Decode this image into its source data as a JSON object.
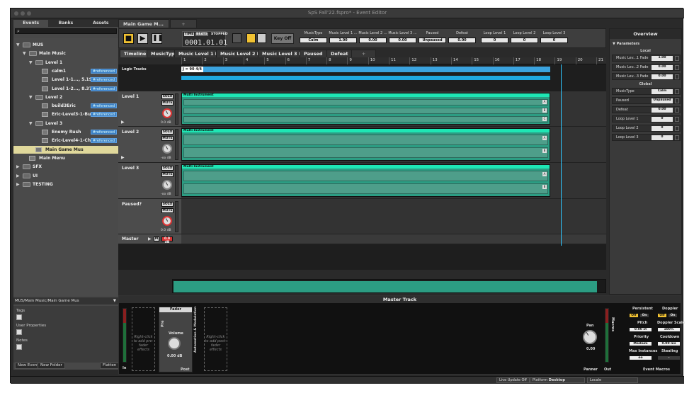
{
  "window": {
    "title": "SpS Fall'22.fspro* - Event Editor"
  },
  "browser": {
    "tabs": [
      "Events",
      "Banks",
      "Assets"
    ],
    "tree": [
      {
        "label": "MUS",
        "kind": "folder",
        "depth": 0,
        "open": true
      },
      {
        "label": "Main Music",
        "kind": "folder",
        "depth": 1,
        "open": true
      },
      {
        "label": "Level 1",
        "kind": "folder",
        "depth": 2,
        "open": true
      },
      {
        "label": "calm1",
        "kind": "event",
        "depth": 3,
        "ref": "#referenced"
      },
      {
        "label": "Level 1-1..., 5.19 PM",
        "kind": "event",
        "depth": 3,
        "ref": "#referenced"
      },
      {
        "label": "Level 1-2..., 8.37 PM",
        "kind": "event",
        "depth": 3,
        "ref": "#referenced"
      },
      {
        "label": "Level 2",
        "kind": "folder",
        "depth": 2,
        "open": true
      },
      {
        "label": "build3Eric",
        "kind": "event",
        "depth": 3,
        "ref": "#referenced"
      },
      {
        "label": "Eric-Level3-1-Build",
        "kind": "event",
        "depth": 3,
        "ref": "#referenced"
      },
      {
        "label": "Level 3",
        "kind": "folder",
        "depth": 2,
        "open": true
      },
      {
        "label": "Enemy Rush",
        "kind": "event",
        "depth": 3,
        "ref": "#referenced"
      },
      {
        "label": "Eric-Level4-1-Chaos",
        "kind": "event",
        "depth": 3,
        "ref": "#referenced"
      },
      {
        "label": "Main Game Mus",
        "kind": "event",
        "depth": 2,
        "selected": true
      },
      {
        "label": "Main Menu",
        "kind": "event",
        "depth": 1
      },
      {
        "label": "SFX",
        "kind": "folder",
        "depth": 0
      },
      {
        "label": "UI",
        "kind": "folder",
        "depth": 0
      },
      {
        "label": "TESTING",
        "kind": "folder",
        "depth": 0
      }
    ],
    "path": "MUS/Main Music/Main Game Mus",
    "props": [
      "Tags",
      "User Properties",
      "Notes"
    ],
    "buttons": {
      "new_event": "New Event",
      "new_folder": "New Folder",
      "flatten": "Flatten"
    }
  },
  "editor_tabs": [
    "Main Game M...",
    "+"
  ],
  "transport": {
    "time_labels": [
      "TIME",
      "BEATS",
      "STOPPED"
    ],
    "time": "0001.01.01",
    "key_off": "Key Off",
    "params": [
      {
        "name": "MusicType",
        "value": "Calm"
      },
      {
        "name": "Music Level 1 ...",
        "value": "1.00"
      },
      {
        "name": "Music Level 2 ...",
        "value": "0.00"
      },
      {
        "name": "Music Level 3 ...",
        "value": "0.00"
      },
      {
        "name": "Paused",
        "value": "Unpaused"
      },
      {
        "name": "Defeat",
        "value": "0.00"
      },
      {
        "name": "Loop Level 1",
        "value": "0"
      },
      {
        "name": "Loop Level 2",
        "value": "0"
      },
      {
        "name": "Loop Level 3",
        "value": "0"
      }
    ]
  },
  "deck_tabs": [
    "Timeline",
    "MusicType",
    "Music Level 1 Fa...",
    "Music Level 2 Fa...",
    "Music Level 3 Fa...",
    "Paused",
    "Defeat",
    "+"
  ],
  "ruler": [
    "1",
    "2",
    "3",
    "4",
    "5",
    "6",
    "7",
    "8",
    "9",
    "10",
    "11",
    "12",
    "13",
    "14",
    "15",
    "16",
    "17",
    "18",
    "19",
    "20",
    "21"
  ],
  "logic_tracks": {
    "label": "Logic Tracks",
    "marker": "J = 90 4/4"
  },
  "tracks": [
    {
      "name": "Level 1",
      "solo": "SOLO",
      "mute": "MUTE",
      "db": "0.0 dB",
      "instrument": "Multi Instrument",
      "keys": [
        "A",
        "B",
        "C"
      ]
    },
    {
      "name": "Level 2",
      "solo": "SOLO",
      "mute": "MUTE",
      "db": "-oo dB",
      "instrument": "Multi Instrument",
      "keys": [
        "A",
        "B"
      ]
    },
    {
      "name": "Level 3",
      "solo": "SOLO",
      "mute": "MUTE",
      "db": "-oo dB",
      "instrument": "Multi Instrument",
      "keys": [
        "A",
        "B"
      ]
    },
    {
      "name": "Paused?",
      "solo": "SOLO",
      "mute": "MUTE",
      "db": "0.0 dB"
    }
  ],
  "master_row": {
    "name": "Master",
    "m": "M",
    "db": "0.0 dB"
  },
  "master_track": {
    "title": "Master Track",
    "pre_slot": "Right-click to add pre-fader effects",
    "post_slot": "Right-click to add post-fader effects",
    "fader": "Fader",
    "pre": "Pre",
    "post": "Post",
    "volume": "Volume",
    "volume_value": "0.00 dB",
    "side_label": "Automation & Modulation",
    "in": "In",
    "out": "Out",
    "pan": "Pan",
    "pan_value": "0.00",
    "panner": "Panner",
    "macros": "Macros",
    "persistent": "Persistent",
    "doppler": "Doppler",
    "off": "Off",
    "on": "On",
    "pitch": "Pitch",
    "pitch_value": "0.00 st",
    "doppler_scale": "Doppler Scale",
    "doppler_value": "100%",
    "priority": "Priority",
    "priority_value": "Medium",
    "cooldown": "Cooldown",
    "cooldown_value": "0.00 ms",
    "max_instances": "Max Instances",
    "max_value": "oo",
    "stealing": "Stealing",
    "stealing_value": "-",
    "event_macros": "Event Macros"
  },
  "overview": {
    "title": "Overview",
    "parameters": "Parameters",
    "local": "Local",
    "global": "Global",
    "local_params": [
      {
        "name": "Music Lev...1 Fade",
        "value": "1.00"
      },
      {
        "name": "Music Lev...2 Fade",
        "value": "0.00"
      },
      {
        "name": "Music Lev...3 Fade",
        "value": "0.00"
      }
    ],
    "global_params": [
      {
        "name": "MusicType",
        "value": "Calm"
      },
      {
        "name": "Paused",
        "value": "Unpaused"
      },
      {
        "name": "Defeat",
        "value": "0.00"
      },
      {
        "name": "Loop Level 1",
        "value": "0"
      },
      {
        "name": "Loop Level 2",
        "value": "0"
      },
      {
        "name": "Loop Level 3",
        "value": "0"
      }
    ]
  },
  "status": {
    "live_update": "Live Update Off",
    "platform_label": "Platform",
    "platform": "Desktop",
    "locale_label": "Locale"
  }
}
